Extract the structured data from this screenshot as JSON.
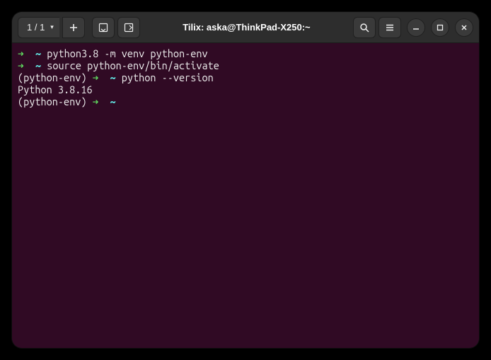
{
  "titlebar": {
    "counter": "1 / 1",
    "title": "Tilix: aska@ThinkPad-X250:~"
  },
  "terminal": {
    "lines": [
      {
        "prefix_arrow": "➜",
        "prefix_tilde": "~",
        "venv": "",
        "text": "python3.8 -m venv python-env"
      },
      {
        "prefix_arrow": "➜",
        "prefix_tilde": "~",
        "venv": "",
        "text": "source python-env/bin/activate"
      },
      {
        "prefix_arrow": "➜",
        "prefix_tilde": "~",
        "venv": "(python-env) ",
        "text": "python --version"
      },
      {
        "prefix_arrow": "",
        "prefix_tilde": "",
        "venv": "",
        "text": "Python 3.8.16"
      },
      {
        "prefix_arrow": "➜",
        "prefix_tilde": "~",
        "venv": "(python-env) ",
        "text": ""
      }
    ]
  }
}
